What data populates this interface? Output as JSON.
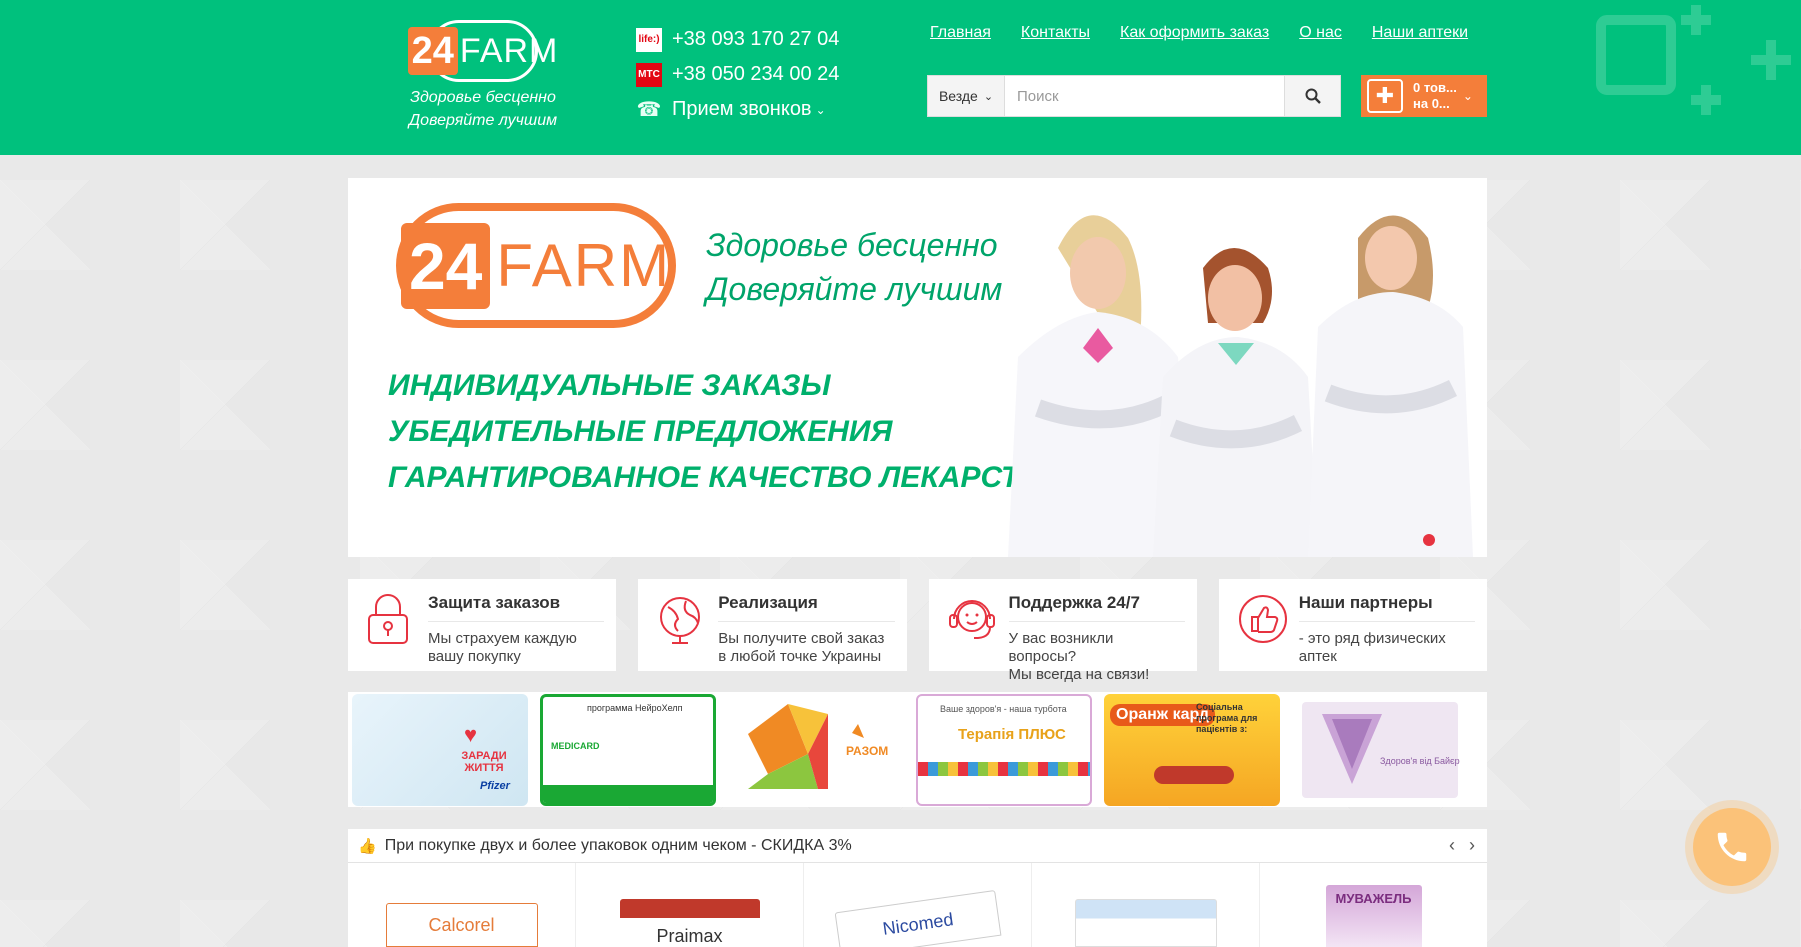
{
  "logo": {
    "number": "24",
    "word": "FARM",
    "slogan_1": "Здоровье бесценно",
    "slogan_2": "Доверяйте лучшим"
  },
  "phones": [
    {
      "operator": "life:)",
      "number": "+38 093 170 27 04"
    },
    {
      "operator": "МТС",
      "number": "+38 050 234 00 24"
    }
  ],
  "calls_label": "Прием звонков",
  "nav": [
    "Главная",
    "Контакты",
    "Как оформить заказ",
    "О нас",
    "Наши аптеки"
  ],
  "search": {
    "scope": "Везде",
    "placeholder": "Поиск"
  },
  "cart": {
    "line1": "0 тов...",
    "line2": "на 0..."
  },
  "banner": {
    "logo_number": "24",
    "logo_word": "FARM",
    "slogan_1": "Здоровье бесценно",
    "slogan_2": "Доверяйте лучшим",
    "line_1": "ИНДИВИДУАЛЬНЫЕ ЗАКАЗЫ",
    "line_2": "УБЕДИТЕЛЬНЫЕ ПРЕДЛОЖЕНИЯ",
    "line_3": "ГАРАНТИРОВАННОЕ КАЧЕСТВО ЛЕКАРСТВ"
  },
  "features": [
    {
      "icon": "lock-icon",
      "title": "Защита заказов",
      "desc_1": "Мы страхуем каждую",
      "desc_2": "вашу покупку"
    },
    {
      "icon": "globe-icon",
      "title": "Реализация",
      "desc_1": "Вы получите свой заказ",
      "desc_2": "в любой точке Украины"
    },
    {
      "icon": "headset-icon",
      "title": "Поддержка 24/7",
      "desc_1": "У вас возникли вопросы?",
      "desc_2": "Мы всегда на связи!"
    },
    {
      "icon": "thumbs-up-icon",
      "title": "Наши партнеры",
      "desc_1": "- это ряд физических",
      "desc_2": "аптек"
    }
  ],
  "partners": [
    {
      "name": "ЗАРАДИ ЖИТТЯ",
      "extra": "Pfizer"
    },
    {
      "name": "MEDICARD",
      "extra": "программа НейроХелп"
    },
    {
      "name": "РАЗОМ",
      "extra": ""
    },
    {
      "name": "Терапія ПЛЮС",
      "extra": "Ваше здоров'я - наша турбота"
    },
    {
      "name": "Оранж кард",
      "extra": "Соціальна програма для пацієнтів з:"
    },
    {
      "name": "Здоров'я від Байєр",
      "extra": ""
    }
  ],
  "promo": "При покупке двух и более упаковок одним чеком - СКИДКА 3%",
  "products": [
    "Calcorel",
    "Praimax",
    "Nicomed",
    "",
    "МУВАЖЕЛЬ"
  ],
  "colors": {
    "brand_green": "#00c17d",
    "accent_orange": "#f47e3a",
    "accent_red": "#e63340"
  }
}
